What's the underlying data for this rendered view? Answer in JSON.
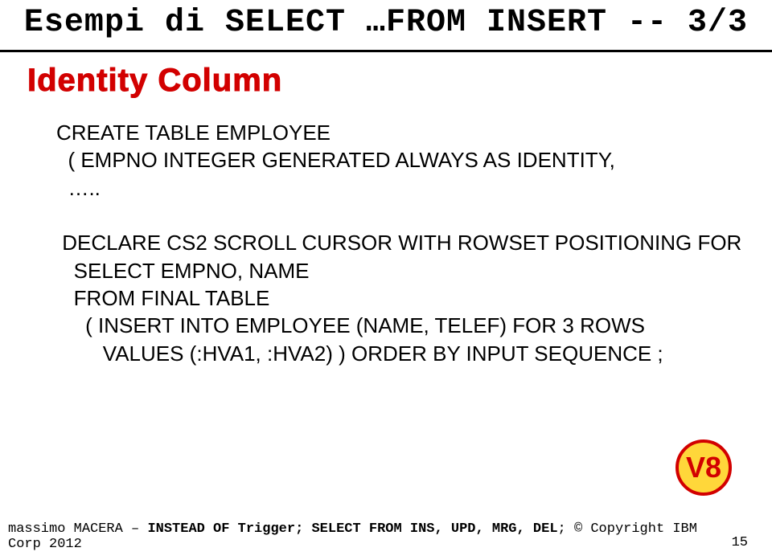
{
  "title": "Esempi di SELECT …FROM INSERT  -- 3/3",
  "subtitle": "Identity Column",
  "code": "CREATE TABLE EMPLOYEE\n  ( EMPNO INTEGER GENERATED ALWAYS AS IDENTITY,\n  …..\n\n DECLARE CS2 SCROLL CURSOR WITH ROWSET POSITIONING FOR\n   SELECT EMPNO, NAME\n   FROM FINAL TABLE\n     ( INSERT INTO EMPLOYEE (NAME, TELEF) FOR 3 ROWS\n        VALUES (:HVA1, :HVA2) ) ORDER BY INPUT SEQUENCE ;",
  "badge": "V8",
  "footer": {
    "author": "massimo MACERA –",
    "topic": "INSTEAD OF Trigger; SELECT FROM INS, UPD, MRG, DEL",
    "sep": ";",
    "copyright": "© Copyright IBM Corp 2012",
    "page": "15"
  }
}
